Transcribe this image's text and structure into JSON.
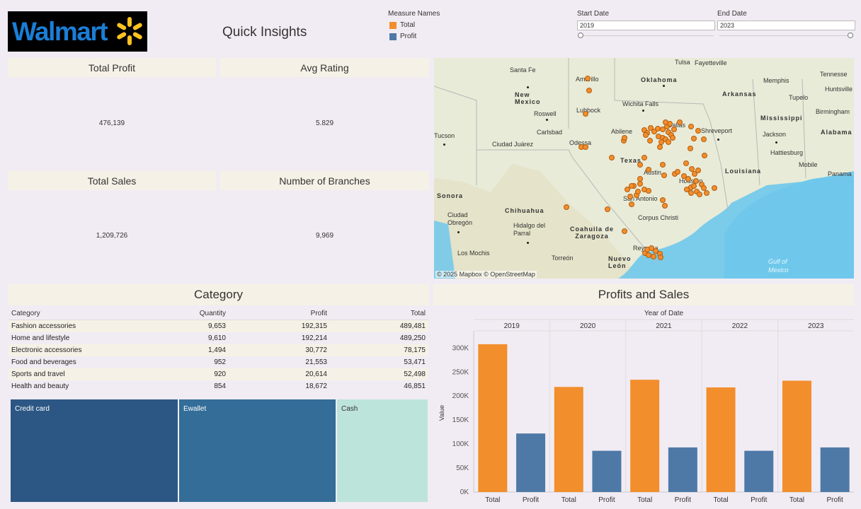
{
  "header": {
    "logo_text": "Walmart",
    "title": "Quick Insights"
  },
  "legend": {
    "title": "Measure Names",
    "items": [
      {
        "label": "Total",
        "color": "#f28e2b"
      },
      {
        "label": "Profit",
        "color": "#4e79a7"
      }
    ]
  },
  "filters": {
    "start": {
      "label": "Start Date",
      "value": "2019"
    },
    "end": {
      "label": "End Date",
      "value": "2023"
    }
  },
  "kpis": {
    "total_profit": {
      "label": "Total Profit",
      "value": "476,139"
    },
    "avg_rating": {
      "label": "Avg Rating",
      "value": "5.829"
    },
    "total_sales": {
      "label": "Total Sales",
      "value": "1,209,726"
    },
    "num_branches": {
      "label": "Number of Branches",
      "value": "9,969"
    }
  },
  "map": {
    "credit": "© 2025 Mapbox © OpenStreetMap",
    "labels": [
      "Tulsa",
      "Fayetteville",
      "Tennesse",
      "Santa Fe",
      "Amarillo",
      "Oklahoma",
      "Memphis",
      "Huntsville",
      "New Mexico",
      "Arkansas",
      "Tupelo",
      "Wichita Falls",
      "Lubbock",
      "Roswell",
      "Mississippi",
      "Birmingham",
      "Dallas",
      "Carlsbad",
      "Abilene",
      "Shreveport",
      "Jackson",
      "Alabama",
      "Tucson",
      "Ciudad Juárez",
      "Odessa",
      "Hattiesburg",
      "Texas",
      "Mobile",
      "Austin",
      "Louisiana",
      "Houston",
      "Panama",
      "Sonora",
      "San Antonio",
      "Chihuahua",
      "Ciudad Obregón",
      "Corpus Christi",
      "Hidalgo del Parral",
      "Coahuila de Zaragoza",
      "Reynosa",
      "Los Mochis",
      "Torreón",
      "Nuevo León",
      "Gulf of Mexico"
    ]
  },
  "category": {
    "title": "Category",
    "columns": [
      "Category",
      "Quantity",
      "Profit",
      "Total"
    ],
    "rows": [
      [
        "Fashion accessories",
        "9,653",
        "192,315",
        "489,481"
      ],
      [
        "Home and lifestyle",
        "9,610",
        "192,214",
        "489,250"
      ],
      [
        "Electronic accessories",
        "1,494",
        "30,772",
        "78,175"
      ],
      [
        "Food and beverages",
        "952",
        "21,553",
        "53,471"
      ],
      [
        "Sports and travel",
        "920",
        "20,614",
        "52,498"
      ],
      [
        "Health and beauty",
        "854",
        "18,672",
        "46,851"
      ]
    ]
  },
  "payment": {
    "items": [
      {
        "label": "Credit card",
        "color": "#2c5784"
      },
      {
        "label": "Ewallet",
        "color": "#336d98"
      },
      {
        "label": "Cash",
        "color": "#bde4da"
      }
    ]
  },
  "chart_data": {
    "type": "bar",
    "title": "Profits and Sales",
    "column_header": "Year of Date",
    "ylabel": "Value",
    "years": [
      "2019",
      "2020",
      "2021",
      "2022",
      "2023"
    ],
    "categories": [
      "Total",
      "Profit"
    ],
    "series": [
      {
        "name": "Total",
        "color": "#f28e2b",
        "values": [
          308000,
          219000,
          234000,
          218000,
          232000
        ]
      },
      {
        "name": "Profit",
        "color": "#4e79a7",
        "values": [
          122000,
          86000,
          93000,
          86000,
          93000
        ]
      }
    ],
    "yticks": [
      0,
      50000,
      100000,
      150000,
      200000,
      250000,
      300000
    ],
    "ytick_labels": [
      "0K",
      "50K",
      "100K",
      "150K",
      "200K",
      "250K",
      "300K"
    ],
    "ylim": [
      0,
      330000
    ]
  }
}
